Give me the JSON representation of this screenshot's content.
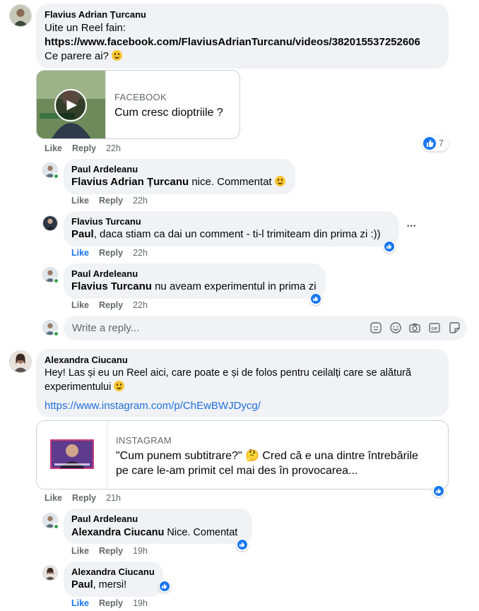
{
  "thread": {
    "c1": {
      "author": "Flavius Adrian Țurcanu",
      "line1": "Uite un Reel fain:",
      "line2": "https://www.facebook.com/FlaviusAdrianTurcanu/videos/382015537252606",
      "line3": "Ce parere ai?",
      "preview": {
        "source": "FACEBOOK",
        "title": "Cum cresc dioptriile ?"
      },
      "actions": {
        "like": "Like",
        "reply": "Reply",
        "time": "22h"
      },
      "reaction_count": "7"
    },
    "r1": {
      "author": "Paul Ardeleanu",
      "mention": "Flavius Adrian Țurcanu",
      "text": " nice. Commentat",
      "actions": {
        "like": "Like",
        "reply": "Reply",
        "time": "22h"
      }
    },
    "r2": {
      "author": "Flavius Turcanu",
      "mention": "Paul",
      "text": ", daca stiam ca dai un comment - ti-l trimiteam din prima zi :))",
      "actions": {
        "like": "Like",
        "reply": "Reply",
        "time": "22h"
      },
      "more": "•••"
    },
    "r3": {
      "author": "Paul Ardeleanu",
      "mention": "Flavius Turcanu",
      "text": " nu aveam experimentul in prima zi",
      "actions": {
        "like": "Like",
        "reply": "Reply",
        "time": "22h"
      }
    },
    "reply_box": {
      "placeholder": "Write a reply..."
    },
    "c2": {
      "author": "Alexandra Ciucanu",
      "line1": "Hey! Las și eu un Reel aici, care poate e și de folos pentru ceilalți care se alătură",
      "line2": "experimentului",
      "link": "https://www.instagram.com/p/ChEwBWJDycg/",
      "preview": {
        "source": "INSTAGRAM",
        "title_line1": "\"Cum punem subtitrare?\" 🤔 Cred că e una dintre întrebările",
        "title_line2": "pe care le-am primit cel mai des în provocarea..."
      },
      "actions": {
        "like": "Like",
        "reply": "Reply",
        "time": "21h"
      }
    },
    "r4": {
      "author": "Paul Ardeleanu",
      "mention": "Alexandra Ciucanu",
      "text": " Nice. Comentat",
      "actions": {
        "like": "Like",
        "reply": "Reply",
        "time": "19h"
      }
    },
    "r5": {
      "author": "Alexandra Ciucanu",
      "mention": "Paul",
      "text": ", mersi!",
      "actions": {
        "like": "Like",
        "reply": "Reply",
        "time": "19h"
      }
    }
  },
  "colors": {
    "accent": "#1877f2",
    "bubble": "#f0f2f5",
    "muted": "#65676b",
    "link": "#216fdb"
  }
}
